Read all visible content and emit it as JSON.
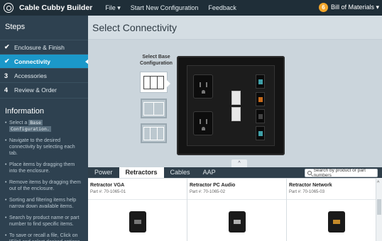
{
  "app": {
    "title": "Cable Cubby Builder"
  },
  "menu": {
    "file": "File ▾",
    "start_new": "Start New Configuration",
    "feedback": "Feedback"
  },
  "bom": {
    "count": "6",
    "label": "Bill of Materials ▾"
  },
  "sidebar": {
    "steps_heading": "Steps",
    "steps": [
      {
        "marker": "✔",
        "label": "Enclosure & Finish"
      },
      {
        "marker": "✔",
        "label": "Connectivity"
      },
      {
        "marker": "3",
        "label": "Accessories"
      },
      {
        "marker": "4",
        "label": "Review & Order"
      }
    ],
    "info_heading": "Information",
    "info": [
      {
        "pre": "Select a ",
        "code1": "Base",
        "code2": "Configuration."
      },
      {
        "text": "Navigate to the desired connectivity by selecting each tab."
      },
      {
        "text": "Place items by dragging them into the enclosure."
      },
      {
        "text": "Remove items by dragging them out of the enclosure."
      },
      {
        "text": "Sorting and filtering items help narrow down available items."
      },
      {
        "text": "Search by product name or part number to find specific items."
      },
      {
        "text": "To save or recall a file, Click on \"File\" and select desired options."
      }
    ]
  },
  "main": {
    "title": "Select Connectivity",
    "base_config_label": "Select Base Configuration",
    "collapse": "^"
  },
  "tabs": [
    "Power",
    "Retractors",
    "Cables",
    "AAP"
  ],
  "search": {
    "placeholder": "Search by product or part numbers"
  },
  "products": [
    {
      "name": "Retractor VGA",
      "part": "Part #: 70-1065-01"
    },
    {
      "name": "Retractor PC Audio",
      "part": "Part #: 70-1065-02"
    },
    {
      "name": "Retractor Network",
      "part": "Part #: 70-1065-03"
    }
  ],
  "colors": {
    "accent": "#1b98c9",
    "sidebar": "#2e4150",
    "topbar": "#1f2e38",
    "badge": "#f4a62a"
  }
}
